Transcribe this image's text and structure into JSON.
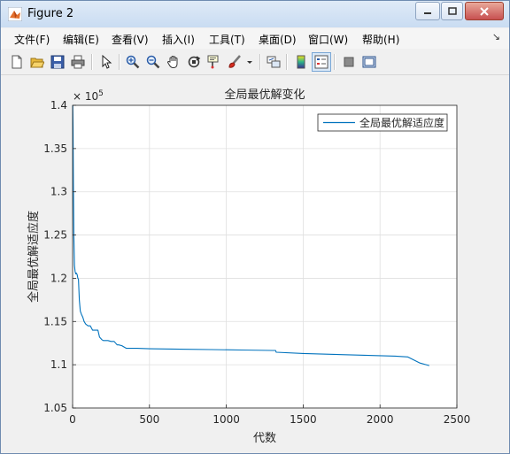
{
  "window": {
    "title": "Figure 2"
  },
  "menubar": {
    "items": [
      {
        "label": "文件(F)"
      },
      {
        "label": "编辑(E)"
      },
      {
        "label": "查看(V)"
      },
      {
        "label": "插入(I)"
      },
      {
        "label": "工具(T)"
      },
      {
        "label": "桌面(D)"
      },
      {
        "label": "窗口(W)"
      },
      {
        "label": "帮助(H)"
      }
    ]
  },
  "toolbar": {
    "icons": [
      "new-figure-icon",
      "open-file-icon",
      "save-icon",
      "print-icon",
      "select-arrow-icon",
      "zoom-in-icon",
      "zoom-out-icon",
      "pan-hand-icon",
      "rotate-3d-icon",
      "data-cursor-icon",
      "brush-icon",
      "dropdown-arrow-icon",
      "link-plot-icon",
      "colorbar-icon",
      "legend-icon",
      "hide-plot-tools-icon",
      "show-plot-tools-icon"
    ]
  },
  "chart_data": {
    "type": "line",
    "title": "全局最优解变化",
    "xlabel": "代数",
    "ylabel": "全局最优解适应度",
    "xlim": [
      0,
      2500
    ],
    "ylim": [
      105000,
      140000
    ],
    "x_ticks": [
      0,
      500,
      1000,
      1500,
      2000,
      2500
    ],
    "x_tick_labels": [
      "0",
      "500",
      "1000",
      "1500",
      "2000",
      "2500"
    ],
    "y_ticks": [
      105000,
      110000,
      115000,
      120000,
      125000,
      130000,
      135000,
      140000
    ],
    "y_tick_labels": [
      "1.05",
      "1.1",
      "1.15",
      "1.2",
      "1.25",
      "1.3",
      "1.35",
      "1.4"
    ],
    "y_exponent_label": "× 10",
    "y_exponent_power": "5",
    "grid": true,
    "legend_position": "top-right",
    "series": [
      {
        "name": "全局最优解适应度",
        "color": "#0072bd",
        "x": [
          1,
          3,
          5,
          8,
          12,
          16,
          20,
          25,
          30,
          34,
          38,
          44,
          50,
          58,
          66,
          75,
          85,
          100,
          115,
          130,
          150,
          165,
          175,
          190,
          200,
          210,
          230,
          250,
          270,
          290,
          300,
          320,
          340,
          350,
          380,
          420,
          500,
          700,
          900,
          1100,
          1300,
          1320,
          1325,
          1500,
          1700,
          1900,
          2100,
          2180,
          2260,
          2310,
          2320
        ],
        "y": [
          140000,
          137500,
          131000,
          125000,
          121500,
          120800,
          120500,
          120600,
          120400,
          120000,
          119900,
          117500,
          116200,
          115800,
          115500,
          115000,
          114700,
          114500,
          114500,
          114000,
          114000,
          114000,
          113200,
          112900,
          112800,
          112800,
          112800,
          112700,
          112700,
          112300,
          112300,
          112200,
          112000,
          111900,
          111900,
          111900,
          111850,
          111800,
          111750,
          111700,
          111650,
          111650,
          111450,
          111300,
          111200,
          111100,
          111000,
          110900,
          110200,
          109950,
          109900
        ]
      }
    ]
  }
}
